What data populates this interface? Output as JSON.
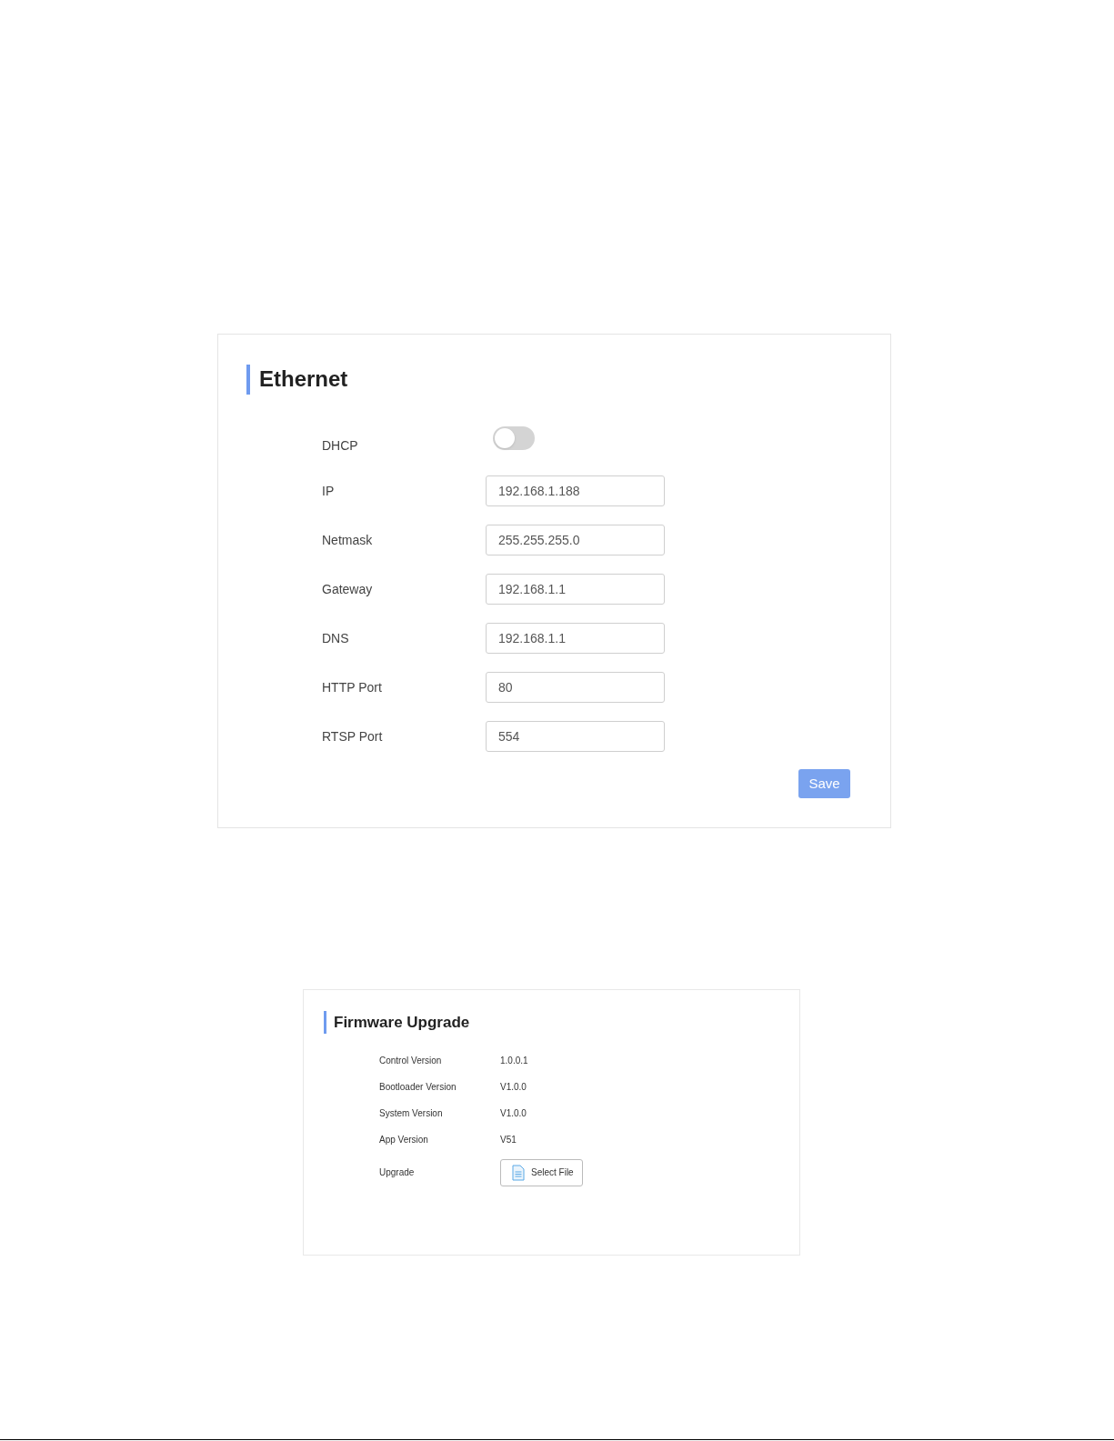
{
  "ethernet": {
    "title": "Ethernet",
    "dhcp": {
      "label": "DHCP",
      "on": false
    },
    "fields": [
      {
        "label": "IP",
        "value": "192.168.1.188"
      },
      {
        "label": "Netmask",
        "value": "255.255.255.0"
      },
      {
        "label": "Gateway",
        "value": "192.168.1.1"
      },
      {
        "label": "DNS",
        "value": "192.168.1.1"
      },
      {
        "label": "HTTP Port",
        "value": "80"
      },
      {
        "label": "RTSP Port",
        "value": "554"
      }
    ],
    "save_button": "Save"
  },
  "firmware": {
    "title": "Firmware Upgrade",
    "rows": [
      {
        "label": "Control Version",
        "value": "1.0.0.1"
      },
      {
        "label": "Bootloader Version",
        "value": "V1.0.0"
      },
      {
        "label": "System Version",
        "value": "V1.0.0"
      },
      {
        "label": "App Version",
        "value": "V51"
      }
    ],
    "upgrade": {
      "label": "Upgrade",
      "button": "Select File"
    }
  }
}
